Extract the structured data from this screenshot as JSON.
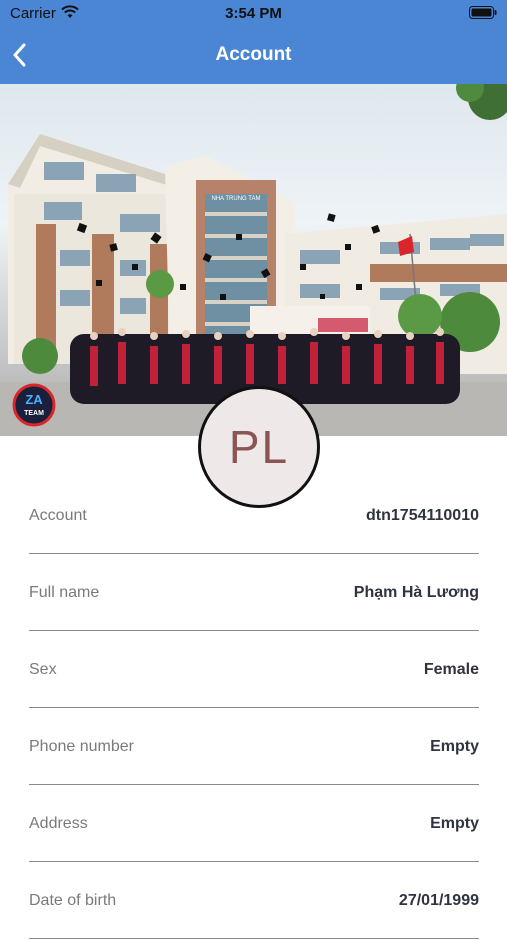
{
  "status_bar": {
    "carrier": "Carrier",
    "time": "3:54 PM"
  },
  "header": {
    "title": "Account",
    "back_icon": "chevron-left-icon",
    "background": "#4a86d4"
  },
  "cover": {
    "logo_text_top": "ZA",
    "logo_text_bottom": "TEAM",
    "building_sign": "NHA TRUNG TAM"
  },
  "avatar": {
    "initials": "PL"
  },
  "fields": [
    {
      "label": "Account",
      "value": "dtn1754110010"
    },
    {
      "label": "Full name",
      "value": "Phạm Hà Lương"
    },
    {
      "label": "Sex",
      "value": "Female"
    },
    {
      "label": "Phone number",
      "value": "Empty"
    },
    {
      "label": "Address",
      "value": "Empty"
    },
    {
      "label": "Date of birth",
      "value": "27/01/1999"
    }
  ]
}
